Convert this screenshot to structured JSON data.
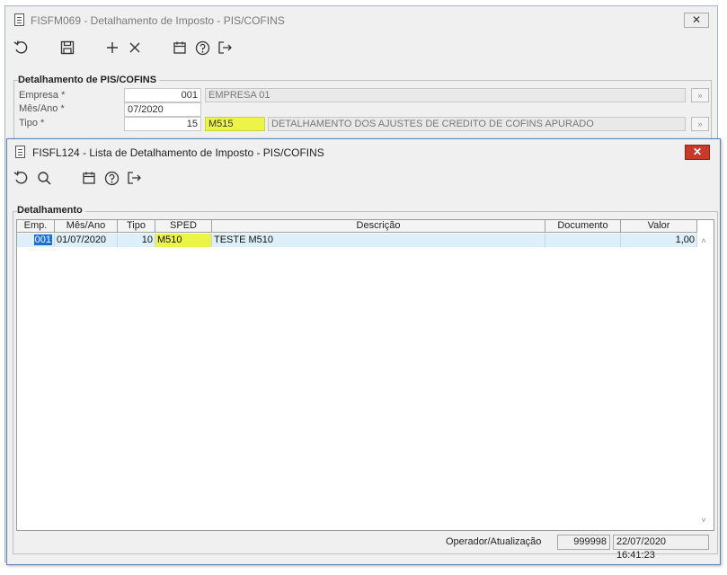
{
  "back_window": {
    "title": "FISFM069 - Detalhamento de Imposto - PIS/COFINS",
    "close_label": "✕",
    "toolbar": [
      "undo-icon",
      "save-icon",
      "add-icon",
      "delete-icon",
      "calendar-icon",
      "help-icon",
      "exit-icon"
    ],
    "group_label": "Detalhamento de PIS/COFINS",
    "fields": {
      "empresa": {
        "label": "Empresa *",
        "code": "001",
        "desc": "EMPRESA 01"
      },
      "mes_ano": {
        "label": "Mês/Ano *",
        "value": "07/2020"
      },
      "tipo": {
        "label": "Tipo *",
        "code": "15",
        "sped": "M515",
        "desc": "DETALHAMENTO DOS AJUSTES DE CREDITO DE COFINS APURADO"
      }
    }
  },
  "front_window": {
    "title": "FISFL124 - Lista de Detalhamento de Imposto - PIS/COFINS",
    "close_label": "✕",
    "toolbar": [
      "undo-icon",
      "search-icon",
      "calendar-icon",
      "help-icon",
      "exit-icon"
    ],
    "group_label": "Detalhamento",
    "columns": [
      "Emp.",
      "Mês/Ano",
      "Tipo",
      "SPED",
      "Descrição",
      "Documento",
      "Valor"
    ],
    "rows": [
      {
        "emp": "001",
        "mes_ano": "01/07/2020",
        "tipo": "10",
        "sped": "M510",
        "descricao": "TESTE M510",
        "documento": "",
        "valor": "1,00"
      }
    ],
    "status": {
      "label": "Operador/Atualização",
      "operador": "999998",
      "atualizacao": "22/07/2020 16:41:23"
    }
  },
  "colors": {
    "highlight_yellow": "#ecf547",
    "selected_row": "#ddeff8",
    "selected_cell": "#1e6fd9",
    "close_red": "#c7392b"
  }
}
